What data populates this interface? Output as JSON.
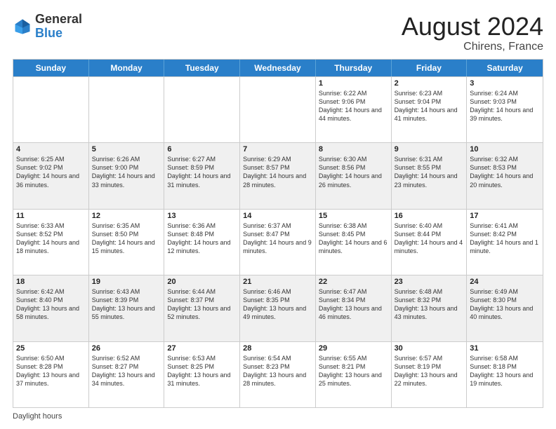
{
  "header": {
    "logo_general": "General",
    "logo_blue": "Blue",
    "month_title": "August 2024",
    "location": "Chirens, France"
  },
  "days_of_week": [
    "Sunday",
    "Monday",
    "Tuesday",
    "Wednesday",
    "Thursday",
    "Friday",
    "Saturday"
  ],
  "footer_label": "Daylight hours",
  "rows": [
    [
      {
        "day": "",
        "info": ""
      },
      {
        "day": "",
        "info": ""
      },
      {
        "day": "",
        "info": ""
      },
      {
        "day": "",
        "info": ""
      },
      {
        "day": "1",
        "info": "Sunrise: 6:22 AM\nSunset: 9:06 PM\nDaylight: 14 hours and 44 minutes."
      },
      {
        "day": "2",
        "info": "Sunrise: 6:23 AM\nSunset: 9:04 PM\nDaylight: 14 hours and 41 minutes."
      },
      {
        "day": "3",
        "info": "Sunrise: 6:24 AM\nSunset: 9:03 PM\nDaylight: 14 hours and 39 minutes."
      }
    ],
    [
      {
        "day": "4",
        "info": "Sunrise: 6:25 AM\nSunset: 9:02 PM\nDaylight: 14 hours and 36 minutes."
      },
      {
        "day": "5",
        "info": "Sunrise: 6:26 AM\nSunset: 9:00 PM\nDaylight: 14 hours and 33 minutes."
      },
      {
        "day": "6",
        "info": "Sunrise: 6:27 AM\nSunset: 8:59 PM\nDaylight: 14 hours and 31 minutes."
      },
      {
        "day": "7",
        "info": "Sunrise: 6:29 AM\nSunset: 8:57 PM\nDaylight: 14 hours and 28 minutes."
      },
      {
        "day": "8",
        "info": "Sunrise: 6:30 AM\nSunset: 8:56 PM\nDaylight: 14 hours and 26 minutes."
      },
      {
        "day": "9",
        "info": "Sunrise: 6:31 AM\nSunset: 8:55 PM\nDaylight: 14 hours and 23 minutes."
      },
      {
        "day": "10",
        "info": "Sunrise: 6:32 AM\nSunset: 8:53 PM\nDaylight: 14 hours and 20 minutes."
      }
    ],
    [
      {
        "day": "11",
        "info": "Sunrise: 6:33 AM\nSunset: 8:52 PM\nDaylight: 14 hours and 18 minutes."
      },
      {
        "day": "12",
        "info": "Sunrise: 6:35 AM\nSunset: 8:50 PM\nDaylight: 14 hours and 15 minutes."
      },
      {
        "day": "13",
        "info": "Sunrise: 6:36 AM\nSunset: 8:48 PM\nDaylight: 14 hours and 12 minutes."
      },
      {
        "day": "14",
        "info": "Sunrise: 6:37 AM\nSunset: 8:47 PM\nDaylight: 14 hours and 9 minutes."
      },
      {
        "day": "15",
        "info": "Sunrise: 6:38 AM\nSunset: 8:45 PM\nDaylight: 14 hours and 6 minutes."
      },
      {
        "day": "16",
        "info": "Sunrise: 6:40 AM\nSunset: 8:44 PM\nDaylight: 14 hours and 4 minutes."
      },
      {
        "day": "17",
        "info": "Sunrise: 6:41 AM\nSunset: 8:42 PM\nDaylight: 14 hours and 1 minute."
      }
    ],
    [
      {
        "day": "18",
        "info": "Sunrise: 6:42 AM\nSunset: 8:40 PM\nDaylight: 13 hours and 58 minutes."
      },
      {
        "day": "19",
        "info": "Sunrise: 6:43 AM\nSunset: 8:39 PM\nDaylight: 13 hours and 55 minutes."
      },
      {
        "day": "20",
        "info": "Sunrise: 6:44 AM\nSunset: 8:37 PM\nDaylight: 13 hours and 52 minutes."
      },
      {
        "day": "21",
        "info": "Sunrise: 6:46 AM\nSunset: 8:35 PM\nDaylight: 13 hours and 49 minutes."
      },
      {
        "day": "22",
        "info": "Sunrise: 6:47 AM\nSunset: 8:34 PM\nDaylight: 13 hours and 46 minutes."
      },
      {
        "day": "23",
        "info": "Sunrise: 6:48 AM\nSunset: 8:32 PM\nDaylight: 13 hours and 43 minutes."
      },
      {
        "day": "24",
        "info": "Sunrise: 6:49 AM\nSunset: 8:30 PM\nDaylight: 13 hours and 40 minutes."
      }
    ],
    [
      {
        "day": "25",
        "info": "Sunrise: 6:50 AM\nSunset: 8:28 PM\nDaylight: 13 hours and 37 minutes."
      },
      {
        "day": "26",
        "info": "Sunrise: 6:52 AM\nSunset: 8:27 PM\nDaylight: 13 hours and 34 minutes."
      },
      {
        "day": "27",
        "info": "Sunrise: 6:53 AM\nSunset: 8:25 PM\nDaylight: 13 hours and 31 minutes."
      },
      {
        "day": "28",
        "info": "Sunrise: 6:54 AM\nSunset: 8:23 PM\nDaylight: 13 hours and 28 minutes."
      },
      {
        "day": "29",
        "info": "Sunrise: 6:55 AM\nSunset: 8:21 PM\nDaylight: 13 hours and 25 minutes."
      },
      {
        "day": "30",
        "info": "Sunrise: 6:57 AM\nSunset: 8:19 PM\nDaylight: 13 hours and 22 minutes."
      },
      {
        "day": "31",
        "info": "Sunrise: 6:58 AM\nSunset: 8:18 PM\nDaylight: 13 hours and 19 minutes."
      }
    ]
  ]
}
